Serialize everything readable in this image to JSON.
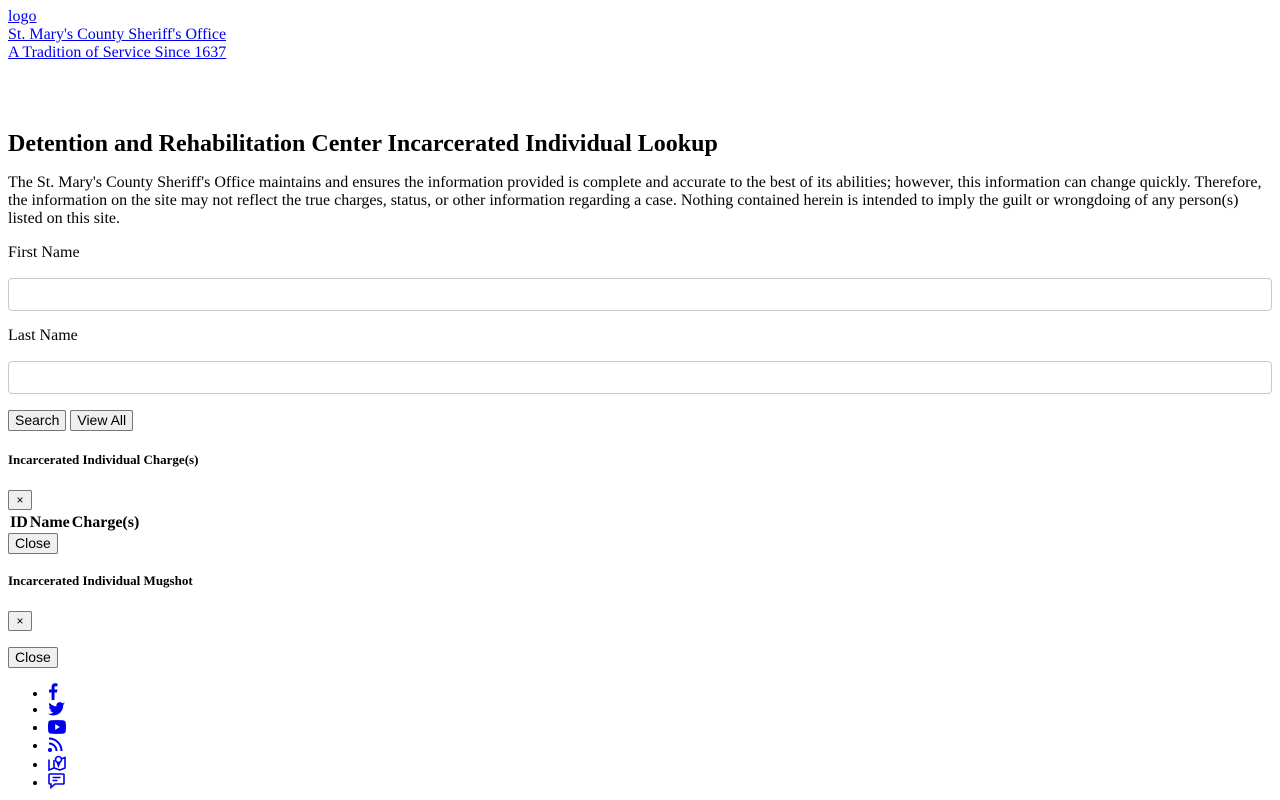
{
  "header": {
    "logo_alt": "logo",
    "org_name": "St. Mary's County Sheriff's Office",
    "tagline": "A Tradition of Service Since 1637"
  },
  "main": {
    "title": "Detention and Rehabilitation Center Incarcerated Individual Lookup",
    "disclaimer": "The St. Mary's County Sheriff's Office maintains and ensures the information provided is complete and accurate to the best of its abilities; however, this information can change quickly. Therefore, the information on the site may not reflect the true charges, status, or other information regarding a case. Nothing contained herein is intended to imply the guilt or wrongdoing of any person(s) listed on this site.",
    "first_name_label": "First Name",
    "first_name_value": "",
    "last_name_label": "Last Name",
    "last_name_value": "",
    "search_label": "Search",
    "view_all_label": "View All"
  },
  "charges_modal": {
    "title": "Incarcerated Individual Charge(s)",
    "close_x": "×",
    "columns": [
      "ID",
      "Name",
      "Charge(s)"
    ],
    "close_label": "Close"
  },
  "mugshot_modal": {
    "title": "Incarcerated Individual Mugshot",
    "close_x": "×",
    "close_label": "Close"
  },
  "social": {
    "icon_color": "#0000ee",
    "items": [
      "facebook-icon",
      "twitter-icon",
      "youtube-icon",
      "rss-icon",
      "map-icon",
      "comment-icon"
    ]
  }
}
